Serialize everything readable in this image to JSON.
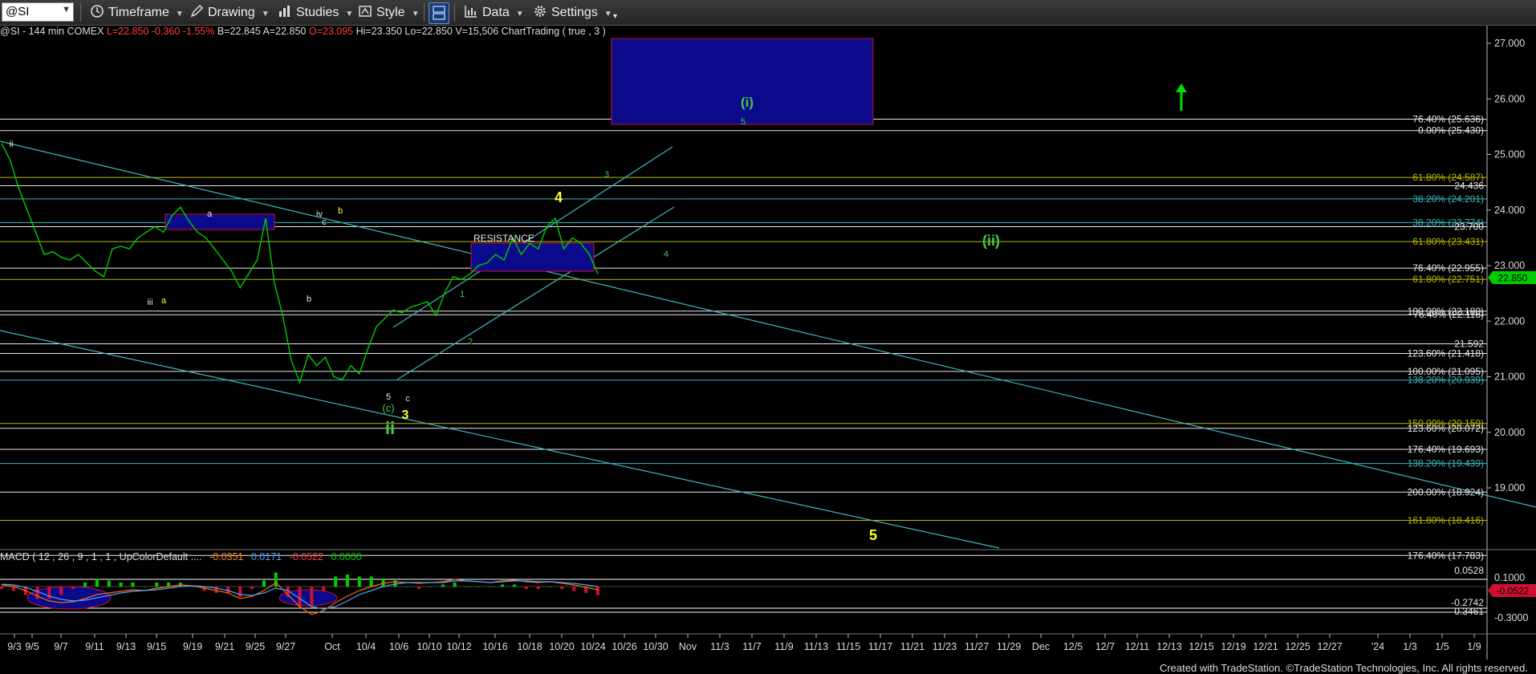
{
  "toolbar": {
    "symbol": "@SI",
    "timeframe_label": "Timeframe",
    "drawing_label": "Drawing",
    "studies_label": "Studies",
    "style_label": "Style",
    "data_label": "Data",
    "settings_label": "Settings"
  },
  "infobar": {
    "symbol": "@SI - 144 min",
    "exchange": "COMEX",
    "last": "L=22.850",
    "change": "-0.360",
    "change_pct": "-1.55%",
    "bid": "B=22.845",
    "ask": "A=22.850",
    "open": "O=23.095",
    "high": "Hi=23.350",
    "low": "Lo=22.850",
    "volume": "V=15,506",
    "study": "ChartTrading ( true , 3 )"
  },
  "macd_label": "MACD ( 12 , 26 , 9 , 1 , 1 , UpColorDefault ....",
  "macd_values": [
    "-0.0351",
    "0.0171",
    "-0.0522",
    "0.0000"
  ],
  "footer": "Created with TradeStation. ©TradeStation Technologies, Inc. All rights reserved.",
  "colors": {
    "price": "#00cc00",
    "last_marker": "#00cc00",
    "trendline": "#3fb7c0",
    "fib_yellow": "#b8b800",
    "fib_white": "#e8e8e8",
    "box_blue": "#0a0a8a",
    "box_border": "#d01030",
    "wave_green": "#44cc44",
    "wave_yellow": "#ffff33"
  },
  "chart_data": {
    "type": "line",
    "title": "@SI - 144 min",
    "ylim": [
      17.75,
      27.3
    ],
    "y_ticks": [
      "27.000",
      "26.000",
      "25.000",
      "24.000",
      "23.000",
      "22.000",
      "21.000",
      "20.000",
      "19.000"
    ],
    "last_price_label": "22.850",
    "x_ticks": [
      "9/3",
      "9/5",
      "9/7",
      "9/11",
      "9/13",
      "9/15",
      "9/19",
      "9/21",
      "9/25",
      "9/27",
      "Oct",
      "10/4",
      "10/6",
      "10/10",
      "10/12",
      "10/16",
      "10/18",
      "10/20",
      "10/24",
      "10/26",
      "10/30",
      "Nov",
      "11/3",
      "11/7",
      "11/9",
      "11/13",
      "11/15",
      "11/17",
      "11/21",
      "11/23",
      "11/27",
      "11/29",
      "Dec",
      "12/5",
      "12/7",
      "12/11",
      "12/13",
      "12/15",
      "12/19",
      "12/21",
      "12/25",
      "12/27",
      "'24",
      "1/3",
      "1/5",
      "1/9"
    ],
    "series": [
      {
        "values": [
          25.2,
          24.9,
          24.4,
          24.0,
          23.6,
          23.2,
          23.25,
          23.15,
          23.1,
          23.2,
          23.05,
          22.9,
          22.8,
          23.3,
          23.35,
          23.3,
          23.5,
          23.6,
          23.7,
          23.6,
          23.9,
          24.05,
          23.8,
          23.6,
          23.5,
          23.3,
          23.1,
          22.9,
          22.6,
          22.85,
          23.1,
          23.85,
          22.7,
          22.1,
          21.3,
          20.9,
          21.4,
          21.2,
          21.35,
          21.0,
          20.95,
          21.2,
          21.05,
          21.5,
          21.9,
          22.05,
          22.2,
          22.15,
          22.25,
          22.3,
          22.35,
          22.1,
          22.5,
          22.8,
          22.75,
          22.85,
          23.0,
          23.05,
          23.2,
          23.1,
          23.5,
          23.2,
          23.4,
          23.3,
          23.7,
          23.85,
          23.3,
          23.5,
          23.4,
          23.2,
          22.85
        ]
      }
    ],
    "fib_levels": [
      {
        "label": "76.40% (25.636)",
        "value": 25.636,
        "color": "#e8e8e8"
      },
      {
        "label": "0.00% (25.430)",
        "value": 25.43,
        "color": "#e8e8e8"
      },
      {
        "label": "61.80% (24.587)",
        "value": 24.587,
        "color": "#b8b800"
      },
      {
        "label": "24.436",
        "value": 24.436,
        "color": "#e8e8e8"
      },
      {
        "label": "38.20% (24.201)",
        "value": 24.201,
        "color": "#3fb7c0"
      },
      {
        "label": "38.20% (23.774)",
        "value": 23.774,
        "color": "#3fb7c0"
      },
      {
        "label": "23.700",
        "value": 23.7,
        "color": "#e8e8e8"
      },
      {
        "label": "61.80% (23.431)",
        "value": 23.431,
        "color": "#b8b800"
      },
      {
        "label": "76.40% (22.955)",
        "value": 22.955,
        "color": "#e8e8e8"
      },
      {
        "label": "61.80% (22.751)",
        "value": 22.751,
        "color": "#b8b800"
      },
      {
        "label": "100.00% (22.180)",
        "value": 22.18,
        "color": "#e8e8e8"
      },
      {
        "label": "76.40% (22.116)",
        "value": 22.116,
        "color": "#e8e8e8"
      },
      {
        "label": "21.592",
        "value": 21.592,
        "color": "#e8e8e8"
      },
      {
        "label": "123.60% (21.418)",
        "value": 21.418,
        "color": "#e8e8e8"
      },
      {
        "label": "100.00% (21.095)",
        "value": 21.095,
        "color": "#e8e8e8"
      },
      {
        "label": "138.20% (20.939)",
        "value": 20.939,
        "color": "#3fb7c0"
      },
      {
        "label": "150.00% (20.159)",
        "value": 20.159,
        "color": "#b8b800"
      },
      {
        "label": "123.60% (20.072)",
        "value": 20.072,
        "color": "#e8e8e8"
      },
      {
        "label": "176.40% (19.693)",
        "value": 19.693,
        "color": "#e8e8e8"
      },
      {
        "label": "138.20% (19.439)",
        "value": 19.439,
        "color": "#3fb7c0"
      },
      {
        "label": "200.00% (18.924)",
        "value": 18.924,
        "color": "#e8e8e8"
      },
      {
        "label": "161.80% (18.416)",
        "value": 18.416,
        "color": "#b8b800"
      },
      {
        "label": "176.40% (17.783)",
        "value": 17.783,
        "color": "#e8e8e8"
      }
    ],
    "annotations": {
      "resistance_label": "RESISTANCE",
      "wave_labels": [
        "ii",
        "iii",
        "a",
        "a",
        "iv",
        "b",
        "c",
        "b",
        "5",
        "(c)",
        "ii",
        "3",
        "c",
        "1",
        "2",
        "4",
        "3",
        "4",
        "(i)",
        "5",
        "(ii)",
        "5"
      ]
    },
    "macd": {
      "y_ticks": [
        "0.1000",
        "-0.3000"
      ],
      "levels": [
        "0.0528",
        "-0.2742",
        "-0.3461"
      ],
      "last_label": "-0.0522",
      "macd_line": [
        0.02,
        0.0,
        -0.05,
        -0.12,
        -0.18,
        -0.2,
        -0.19,
        -0.15,
        -0.1,
        -0.08,
        -0.06,
        -0.04,
        -0.05,
        -0.02,
        0.0,
        0.02,
        0.01,
        -0.02,
        -0.05,
        -0.08,
        -0.15,
        -0.12,
        -0.05,
        0.05,
        -0.1,
        -0.25,
        -0.35,
        -0.3,
        -0.2,
        -0.12,
        -0.05,
        0.0,
        0.04,
        0.06,
        0.05,
        0.04,
        0.05,
        0.06,
        0.09,
        0.07,
        0.06,
        0.05,
        0.07,
        0.08,
        0.06,
        0.05,
        0.06,
        0.04,
        0.02,
        -0.01,
        -0.04
      ],
      "signal_line": [
        0.03,
        0.02,
        -0.01,
        -0.06,
        -0.12,
        -0.16,
        -0.18,
        -0.17,
        -0.14,
        -0.11,
        -0.08,
        -0.06,
        -0.05,
        -0.04,
        -0.02,
        0.0,
        0.01,
        0.0,
        -0.02,
        -0.05,
        -0.1,
        -0.11,
        -0.08,
        -0.02,
        -0.05,
        -0.15,
        -0.25,
        -0.28,
        -0.25,
        -0.18,
        -0.1,
        -0.05,
        0.0,
        0.03,
        0.05,
        0.05,
        0.05,
        0.05,
        0.07,
        0.07,
        0.06,
        0.05,
        0.06,
        0.07,
        0.07,
        0.06,
        0.06,
        0.05,
        0.04,
        0.02,
        0.0
      ]
    }
  }
}
